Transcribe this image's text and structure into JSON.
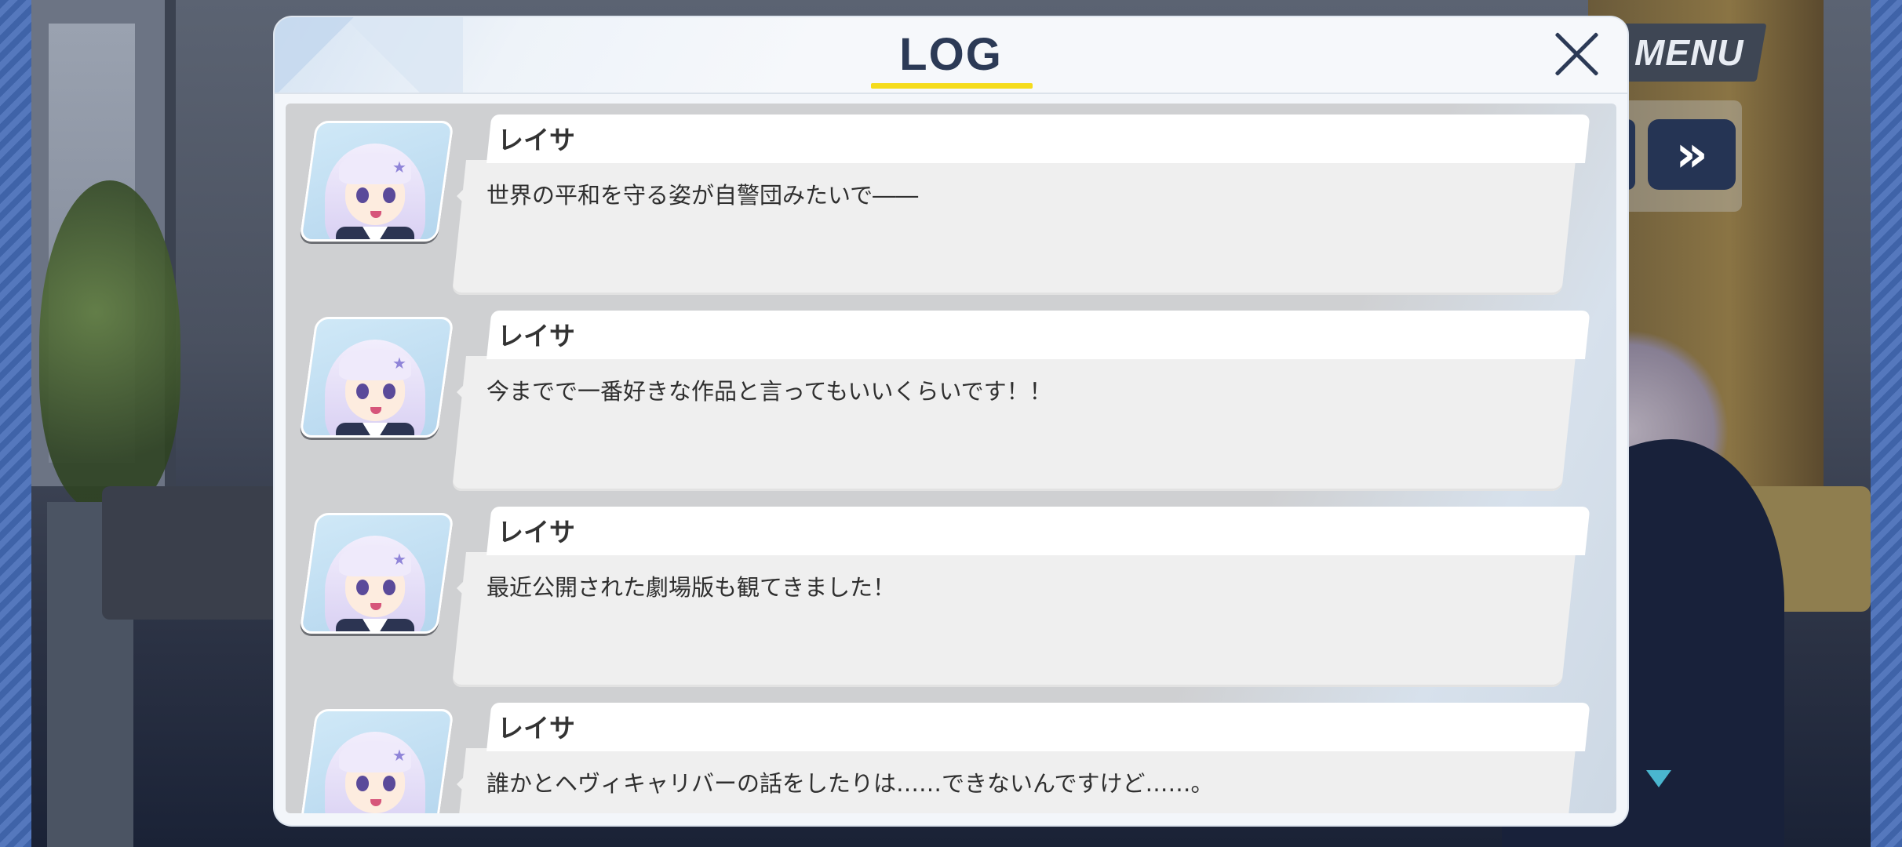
{
  "hud": {
    "menu_label": "MENU",
    "fast_forward_label": "»"
  },
  "log": {
    "title": "LOG",
    "entries": [
      {
        "speaker": "レイサ",
        "text": "世界の平和を守る姿が自警団みたいで――"
      },
      {
        "speaker": "レイサ",
        "text": "今までで一番好きな作品と言ってもいいくらいです！！"
      },
      {
        "speaker": "レイサ",
        "text": "最近公開された劇場版も観てきました！"
      },
      {
        "speaker": "レイサ",
        "text": "誰かとヘヴィキャリバーの話をしたりは……できないんですけど……。"
      }
    ]
  },
  "colors": {
    "title_underline": "#f5dc1c",
    "title_text": "#2c3a56",
    "next_indicator": "#4ab6cf"
  }
}
